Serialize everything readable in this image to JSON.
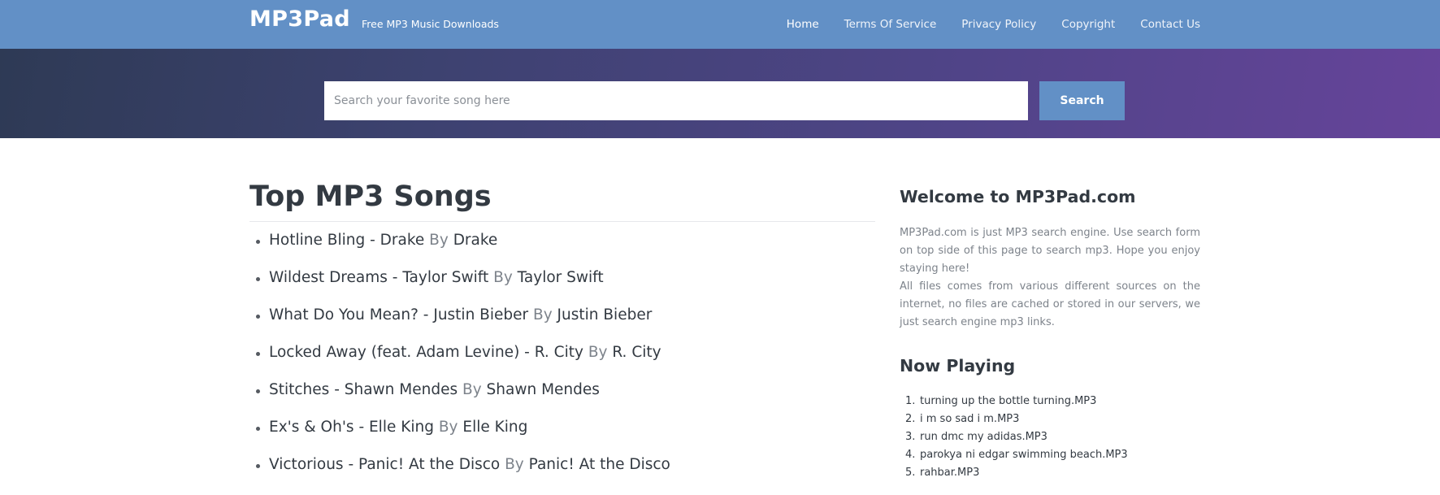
{
  "header": {
    "brand": "MP3Pad",
    "tagline": "Free MP3 Music Downloads",
    "nav": [
      {
        "label": "Home"
      },
      {
        "label": "Terms Of Service"
      },
      {
        "label": "Privacy Policy"
      },
      {
        "label": "Copyright"
      },
      {
        "label": "Contact Us"
      }
    ]
  },
  "search": {
    "placeholder": "Search your favorite song here",
    "value": "",
    "button_label": "Search"
  },
  "main": {
    "title": "Top MP3 Songs",
    "by_label": "By",
    "songs": [
      {
        "title": "Hotline Bling - Drake",
        "artist": "Drake"
      },
      {
        "title": "Wildest Dreams - Taylor Swift",
        "artist": "Taylor Swift"
      },
      {
        "title": "What Do You Mean? - Justin Bieber",
        "artist": "Justin Bieber"
      },
      {
        "title": "Locked Away (feat. Adam Levine) - R. City",
        "artist": "R. City"
      },
      {
        "title": "Stitches - Shawn Mendes",
        "artist": "Shawn Mendes"
      },
      {
        "title": "Ex's & Oh's - Elle King",
        "artist": "Elle King"
      },
      {
        "title": "Victorious - Panic! At the Disco",
        "artist": "Panic! At the Disco"
      }
    ]
  },
  "sidebar": {
    "welcome_title": "Welcome to MP3Pad.com",
    "welcome_p1": "MP3Pad.com is just MP3 search engine. Use search form on top side of this page to search mp3. Hope you enjoy staying here!",
    "welcome_p2": "All files comes from various different sources on the internet, no files are cached or stored in our servers, we just search engine mp3 links.",
    "now_playing_title": "Now Playing",
    "now_playing": [
      {
        "num": "1.",
        "label": "turning up the bottle turning.MP3"
      },
      {
        "num": "2.",
        "label": "i m so sad i m.MP3"
      },
      {
        "num": "3.",
        "label": "run dmc my adidas.MP3"
      },
      {
        "num": "4.",
        "label": "parokya ni edgar swimming beach.MP3"
      },
      {
        "num": "5.",
        "label": "rahbar.MP3"
      }
    ]
  },
  "colors": {
    "accent": "#6290c6",
    "banner_gradient_start": "#2e3a55",
    "banner_gradient_end": "#66449a",
    "text": "#333a42",
    "muted_text": "#7d838b"
  }
}
